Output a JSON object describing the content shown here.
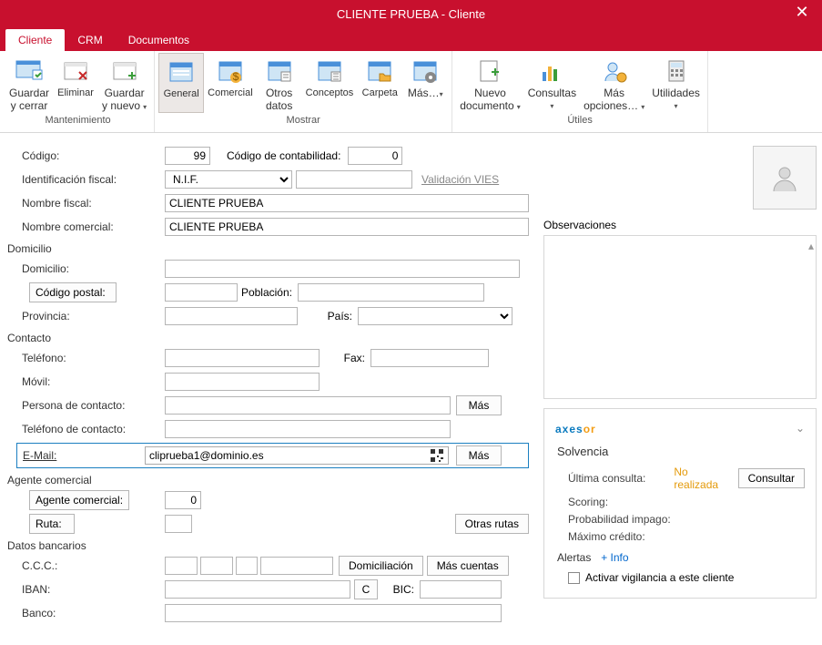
{
  "title": "CLIENTE PRUEBA - Cliente",
  "tabs": {
    "cliente": "Cliente",
    "crm": "CRM",
    "documentos": "Documentos"
  },
  "ribbon": {
    "mantenimiento": {
      "label": "Mantenimiento",
      "guardar_cerrar": "Guardar\ny cerrar",
      "eliminar": "Eliminar",
      "guardar_nuevo": "Guardar\ny nuevo"
    },
    "mostrar": {
      "label": "Mostrar",
      "general": "General",
      "comercial": "Comercial",
      "otros_datos": "Otros\ndatos",
      "conceptos": "Conceptos",
      "carpeta": "Carpeta",
      "mas": "Más…"
    },
    "utiles": {
      "label": "Útiles",
      "nuevo_documento": "Nuevo\ndocumento",
      "consultas": "Consultas",
      "mas_opciones": "Más\nopciones…",
      "utilidades": "Utilidades"
    }
  },
  "labels": {
    "codigo": "Código:",
    "codigo_cont": "Código de contabilidad:",
    "identificacion_fiscal": "Identificación fiscal:",
    "validacion_vies": "Validación VIES",
    "nombre_fiscal": "Nombre fiscal:",
    "nombre_comercial": "Nombre comercial:",
    "domicilio_section": "Domicilio",
    "domicilio": "Domicilio:",
    "codigo_postal_btn": "Código postal:",
    "poblacion": "Población:",
    "provincia": "Provincia:",
    "pais": "País:",
    "contacto_section": "Contacto",
    "telefono": "Teléfono:",
    "fax": "Fax:",
    "movil": "Móvil:",
    "persona_contacto": "Persona de contacto:",
    "telefono_contacto": "Teléfono de contacto:",
    "email": "E-Mail:",
    "mas_btn": "Más",
    "agente_section": "Agente comercial",
    "agente_btn": "Agente comercial:",
    "ruta_btn": "Ruta:",
    "otras_rutas": "Otras rutas",
    "datos_bancarios_section": "Datos bancarios",
    "ccc": "C.C.C.:",
    "domiciliacion": "Domiciliación",
    "mas_cuentas": "Más cuentas",
    "iban": "IBAN:",
    "c_btn": "C",
    "bic": "BIC:",
    "banco": "Banco:",
    "observaciones": "Observaciones"
  },
  "values": {
    "codigo": "99",
    "codigo_cont": "0",
    "id_fiscal_type": "N.I.F.",
    "id_fiscal_num": "",
    "nombre_fiscal": "CLIENTE PRUEBA",
    "nombre_comercial": "CLIENTE PRUEBA",
    "domicilio": "",
    "codigo_postal": "",
    "poblacion": "",
    "provincia": "",
    "pais": "",
    "telefono": "",
    "fax": "",
    "movil": "",
    "persona_contacto": "",
    "telefono_contacto": "",
    "email": "cliprueba1@dominio.es",
    "agente": "0",
    "ruta": "",
    "ccc1": "",
    "ccc2": "",
    "ccc3": "",
    "ccc4": "",
    "iban": "",
    "bic": "",
    "banco": ""
  },
  "axesor": {
    "logo1": "axes",
    "logo2": "or",
    "solvencia": "Solvencia",
    "ultima_consulta_lbl": "Última consulta:",
    "ultima_consulta_val": "No realizada",
    "consultar_btn": "Consultar",
    "scoring": "Scoring:",
    "prob_impago": "Probabilidad impago:",
    "max_credito": "Máximo crédito:",
    "alertas": "Alertas",
    "info_link": "+ Info",
    "activar": "Activar vigilancia a este cliente"
  }
}
